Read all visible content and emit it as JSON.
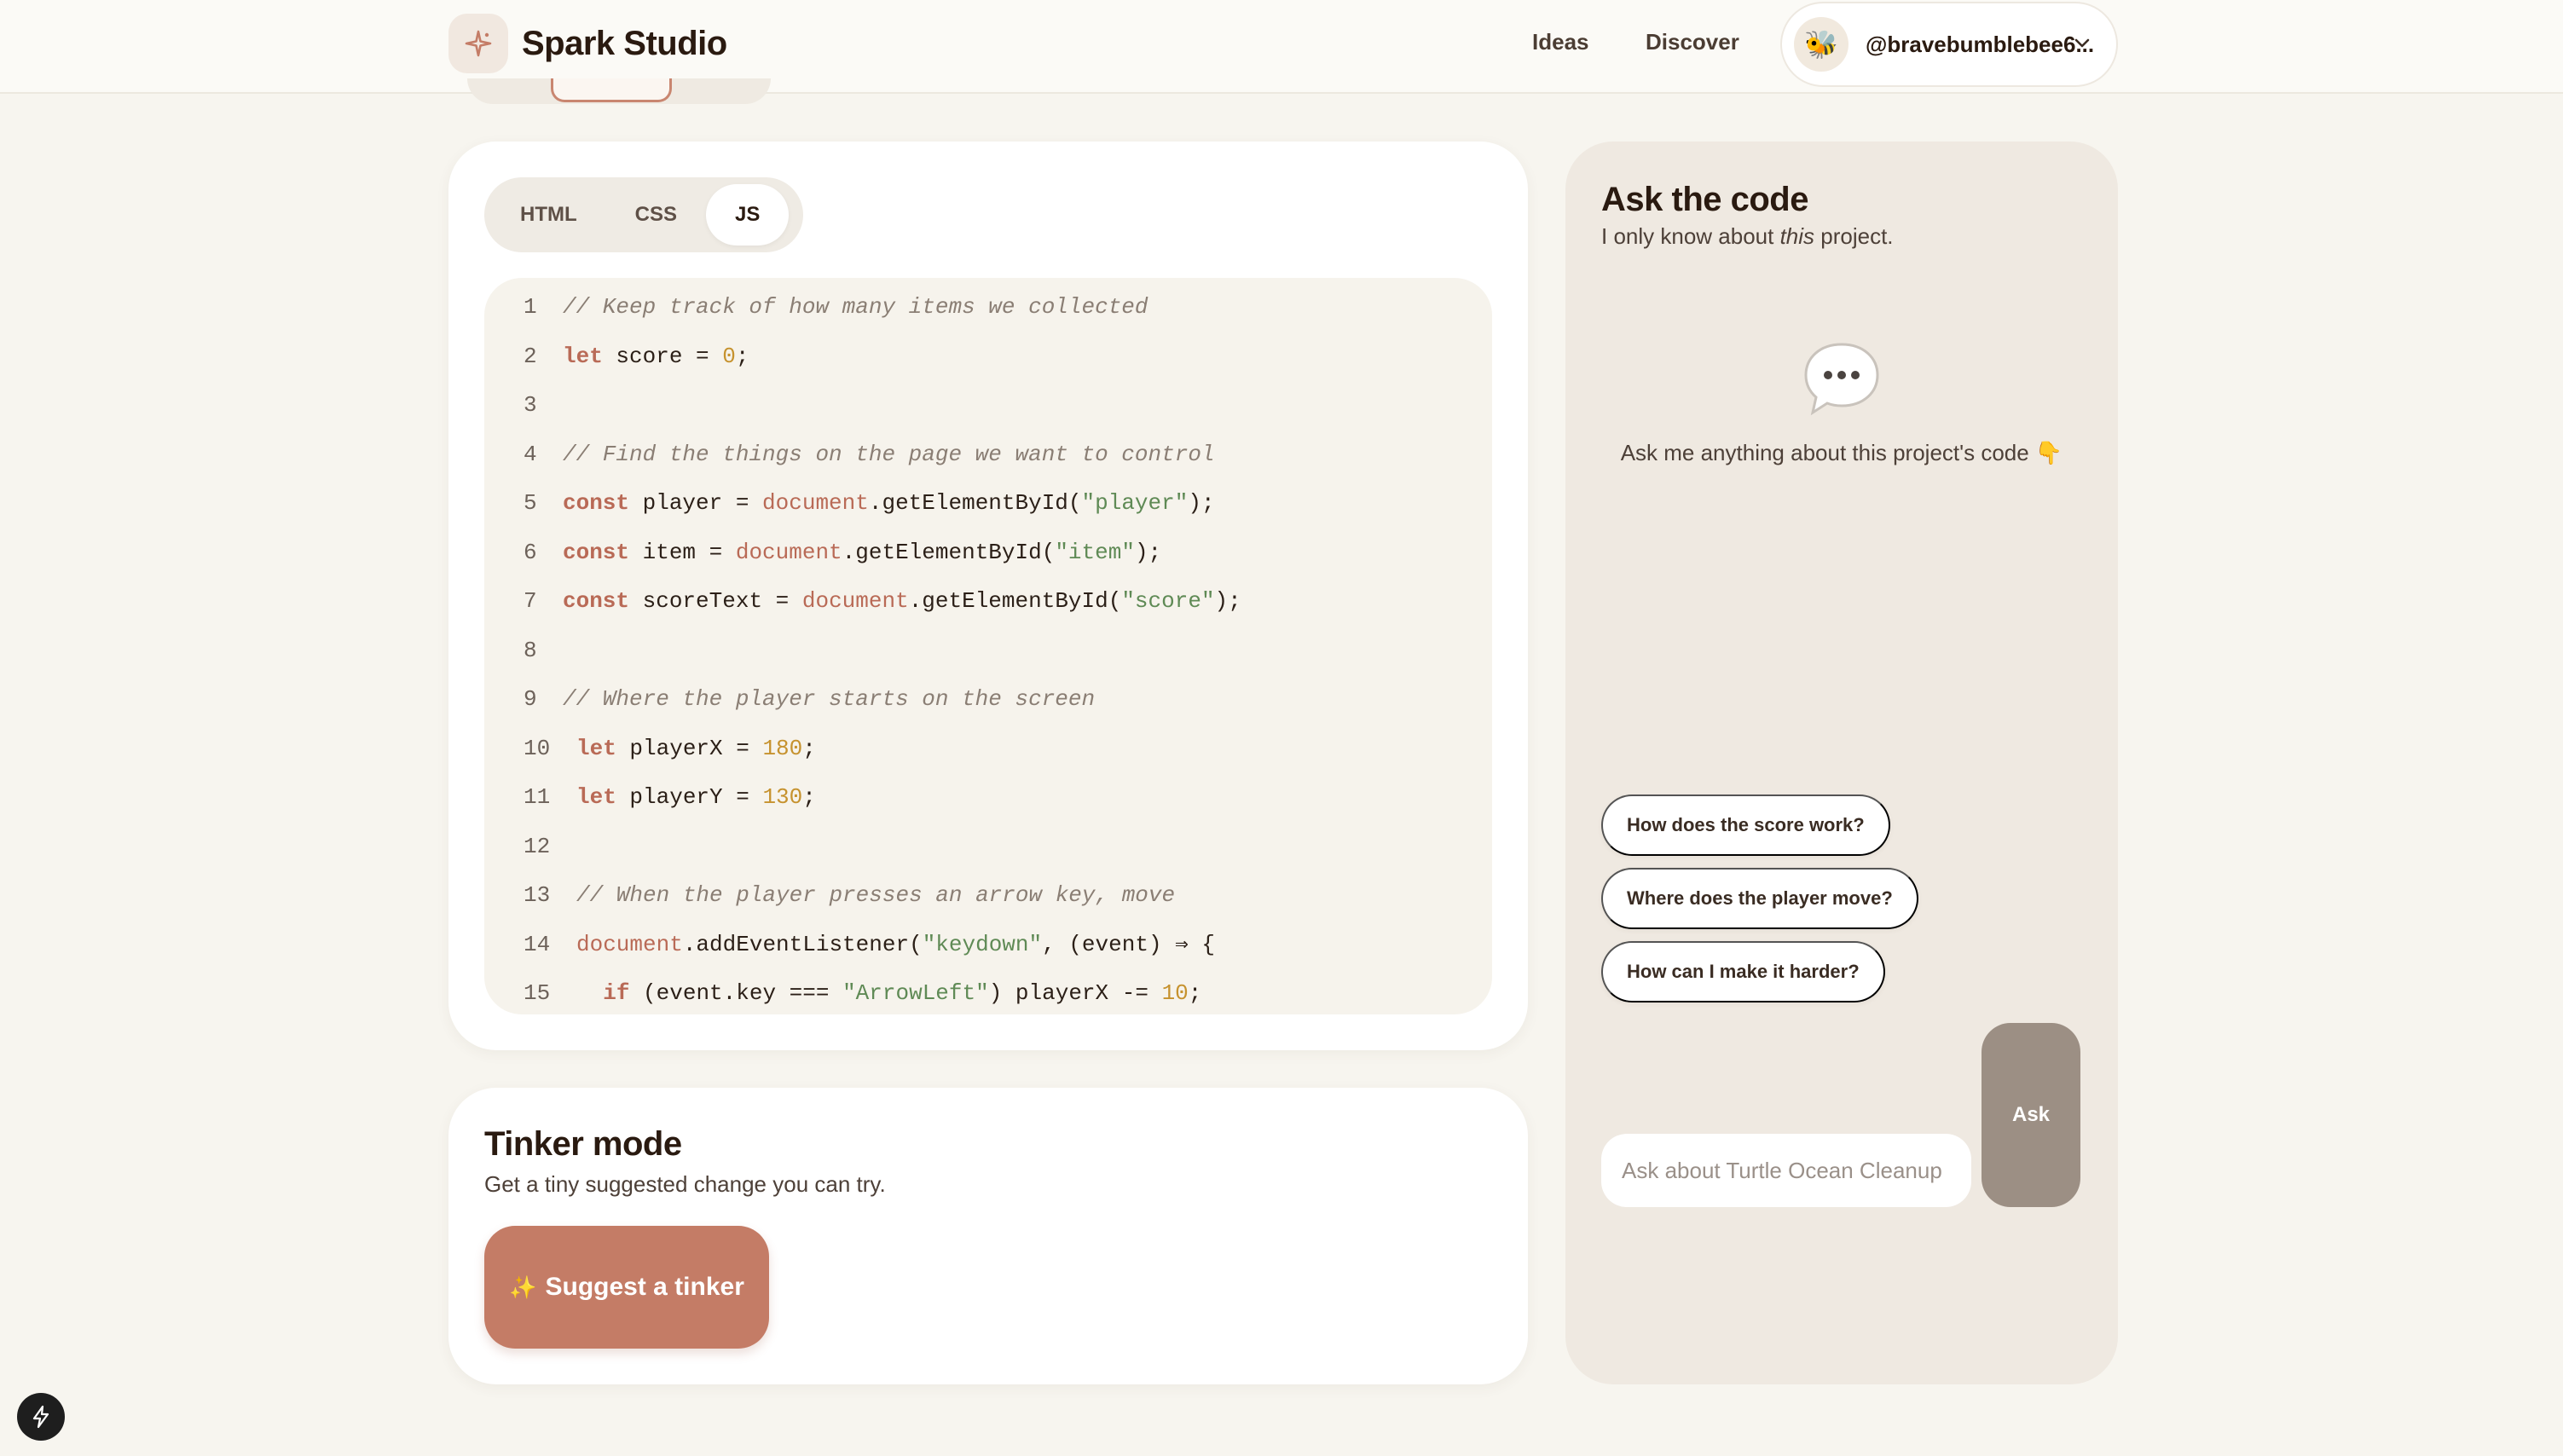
{
  "header": {
    "brand": "Spark Studio",
    "nav": [
      "Ideas",
      "Discover"
    ],
    "user": {
      "handle": "@bravebumblebee6...",
      "avatar_emoji": "🐝"
    }
  },
  "code_tabs": {
    "tabs": [
      "HTML",
      "CSS",
      "JS"
    ],
    "active": "JS"
  },
  "code": {
    "lines": [
      {
        "n": "1",
        "text": "// Keep track of how many items we collected"
      },
      {
        "n": "2",
        "text": "let score = 0;"
      },
      {
        "n": "3",
        "text": ""
      },
      {
        "n": "4",
        "text": "// Find the things on the page we want to control"
      },
      {
        "n": "5",
        "text": "const player = document.getElementById(\"player\");"
      },
      {
        "n": "6",
        "text": "const item = document.getElementById(\"item\");"
      },
      {
        "n": "7",
        "text": "const scoreText = document.getElementById(\"score\");"
      },
      {
        "n": "8",
        "text": ""
      },
      {
        "n": "9",
        "text": "// Where the player starts on the screen"
      },
      {
        "n": "10",
        "text": "let playerX = 180;"
      },
      {
        "n": "11",
        "text": "let playerY = 130;"
      },
      {
        "n": "12",
        "text": ""
      },
      {
        "n": "13",
        "text": "// When the player presses an arrow key, move"
      },
      {
        "n": "14",
        "text": "document.addEventListener(\"keydown\", (event) ⇒ {"
      },
      {
        "n": "15",
        "text": "  if (event.key === \"ArrowLeft\") playerX -= 10;"
      }
    ]
  },
  "tinker": {
    "title": "Tinker mode",
    "subtitle": "Get a tiny suggested change you can try.",
    "button_icon": "✨",
    "button_label": "Suggest a tinker"
  },
  "ask": {
    "title": "Ask the code",
    "subtitle_before": "I only know about ",
    "subtitle_em": "this",
    "subtitle_after": " project.",
    "empty_text": "Ask me anything about this project's code 👇",
    "suggestions": [
      "How does the score work?",
      "Where does the player move?",
      "How can I make it harder?"
    ],
    "input_placeholder": "Ask about Turtle Ocean Cleanup",
    "input_value": "",
    "button_label": "Ask"
  },
  "icons": {
    "brand": "sparkle-icon",
    "caret": "chevron-down-icon",
    "empty": "speech-bubble-icon",
    "dev": "lightning-icon"
  },
  "colors": {
    "accent": "#c47c66",
    "page_bg": "#f7f5ef",
    "panel_bg": "#efe9e1",
    "code_bg": "#f6f3ec",
    "ask_button": "#9c8f84"
  }
}
